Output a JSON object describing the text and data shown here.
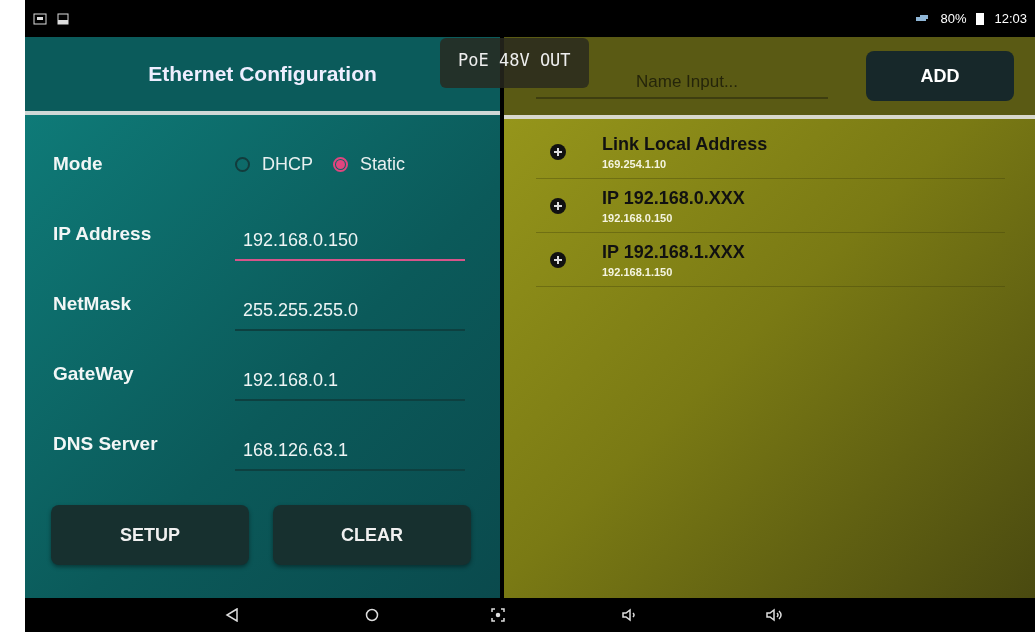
{
  "status_bar": {
    "battery": "80%",
    "time": "12:03"
  },
  "config": {
    "title": "Ethernet Configuration",
    "mode": {
      "label": "Mode",
      "options": [
        {
          "label": "DHCP",
          "selected": false
        },
        {
          "label": "Static",
          "selected": true
        }
      ]
    },
    "fields": [
      {
        "label": "IP Address",
        "value": "192.168.0.150",
        "focused": true
      },
      {
        "label": "NetMask",
        "value": "255.255.255.0",
        "focused": false
      },
      {
        "label": "GateWay",
        "value": "192.168.0.1",
        "focused": false
      },
      {
        "label": "DNS Server",
        "value": "168.126.63.1",
        "focused": false
      }
    ],
    "buttons": [
      "SETUP",
      "CLEAR"
    ]
  },
  "toast": "PoE 48V OUT",
  "presets": {
    "name_input": {
      "placeholder": "Name Input..."
    },
    "add_button": "ADD",
    "items": [
      {
        "title": "Link Local Address",
        "address": "169.254.1.10"
      },
      {
        "title": "IP 192.168.0.XXX",
        "address": "192.168.0.150"
      },
      {
        "title": "IP 192.168.1.XXX",
        "address": "192.168.1.150"
      }
    ]
  }
}
